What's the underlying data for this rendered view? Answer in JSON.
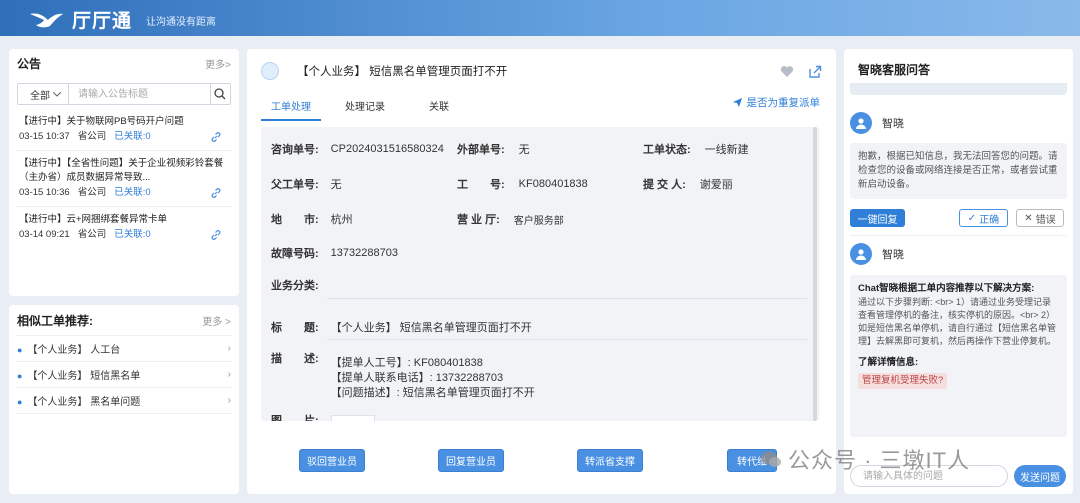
{
  "header": {
    "app_name": "厅厅通",
    "slogan": "让沟通没有距离"
  },
  "announcements": {
    "title": "公告",
    "more": "更多>",
    "filter_selected": "全部",
    "search_placeholder": "请输入公告标题",
    "items": [
      {
        "title": "【进行中】关于物联网PB号码开户问题",
        "date": "03-15 10:37",
        "org": "省公司",
        "related": "已关联:0"
      },
      {
        "title": "【进行中】【全省性问题】关于企业视频彩铃套餐（主办省）成员数据异常导致...",
        "date": "03-15 10:36",
        "org": "省公司",
        "related": "已关联:0"
      },
      {
        "title": "【进行中】云+网捆绑套餐异常卡单",
        "date": "03-14 09:21",
        "org": "省公司",
        "related": "已关联:0"
      }
    ]
  },
  "similar": {
    "title": "相似工单推荐:",
    "more": "更多",
    "items": [
      "【个人业务】 人工台",
      "【个人业务】 短信黑名单",
      "【个人业务】 黑名单问题"
    ]
  },
  "ticket": {
    "title": "【个人业务】 短信黑名单管理页面打不开",
    "tabs": [
      "工单处理",
      "处理记录",
      "关联"
    ],
    "redispatch": "是否为重复派单",
    "fields": {
      "consult_no_label": "咨询单号:",
      "consult_no": "CP2024031516580324",
      "external_no_label": "外部单号:",
      "external_no": "无",
      "status_label": "工单状态:",
      "status": "一线新建",
      "parent_no_label": "父工单号:",
      "parent_no": "无",
      "job_no_label": "工　　号:",
      "job_no": "KF080401838",
      "submitter_label": "提 交 人:",
      "submitter": "谢爱丽",
      "city_label": "地　　市:",
      "city": "杭州",
      "hall_label": "营 业 厅:",
      "hall": "客户服务部",
      "fault_no_label": "故障号码:",
      "fault_no": "13732288703",
      "biz_cat_label": "业务分类:",
      "biz_cat": "",
      "subject_label": "标　　题:",
      "subject": "【个人业务】 短信黑名单管理页面打不开",
      "desc_label": "描　　述:",
      "desc_lines": [
        "【提单人工号】: KF080401838",
        "【提单人联系电话】: 13732288703",
        "【问题描述】: 短信黑名单管理页面打不开"
      ],
      "image_label": "图　　片:"
    },
    "buttons": [
      "驳回营业员",
      "回复营业员",
      "转派省支撑",
      "转代维"
    ]
  },
  "chat": {
    "title": "智晓客服问答",
    "bot_name": "智晓",
    "msg1": "抱歉，根据已知信息，我无法回答您的问题。请检查您的设备或网络连接是否正常，或者尝试重新启动设备。",
    "reply_btn": "一键回复",
    "correct_btn": "正确",
    "wrong_btn": "错误",
    "msg2_title": "Chat智晓根据工单内容推荐以下解决方案:",
    "msg2_body": "通过以下步骤判断: <br> 1）请通过业务受理记录查看管理停机的备注，核实停机的原因。<br> 2）如是短信黑名单停机，请自行通过【短信黑名单管理】去解黑即可复机，然后再操作下营业停复机。",
    "detail_title": "了解详情信息:",
    "detail_tag": "管理复机受理失败?",
    "input_placeholder": "请输入具体的问题",
    "send_btn": "发送问题"
  },
  "watermark": "公众号 · 三墩IT人",
  "colors": {
    "accent": "#4a90e2",
    "link": "#2f7fd8",
    "tag_bg": "#f6dede"
  }
}
